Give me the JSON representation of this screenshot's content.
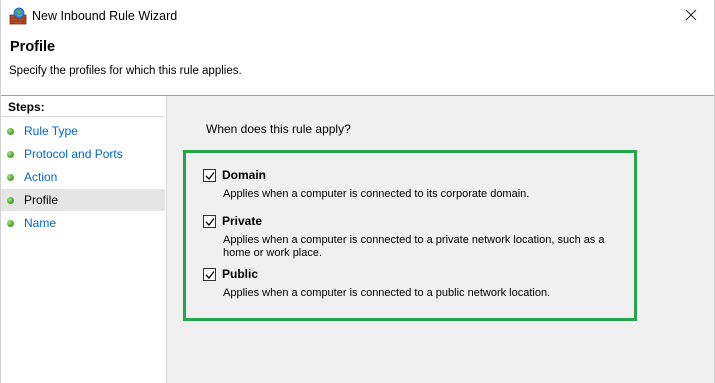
{
  "window": {
    "title": "New Inbound Rule Wizard",
    "app_icon": "firewall-icon",
    "close_icon": "close-icon"
  },
  "header": {
    "title": "Profile",
    "subtitle": "Specify the profiles for which this rule applies."
  },
  "steps": {
    "title": "Steps:",
    "items": [
      {
        "label": "Rule Type",
        "active": false
      },
      {
        "label": "Protocol and Ports",
        "active": false
      },
      {
        "label": "Action",
        "active": false
      },
      {
        "label": "Profile",
        "active": true
      },
      {
        "label": "Name",
        "active": false
      }
    ]
  },
  "main": {
    "question": "When does this rule apply?",
    "options": [
      {
        "label": "Domain",
        "checked": true,
        "description": "Applies when a computer is connected to its corporate domain."
      },
      {
        "label": "Private",
        "checked": true,
        "description": "Applies when a computer is connected to a private network location, such as a home or work place."
      },
      {
        "label": "Public",
        "checked": true,
        "description": "Applies when a computer is connected to a public network location."
      }
    ]
  },
  "colors": {
    "highlight_border": "#22a84a",
    "step_link": "#0066cc",
    "content_bg": "#f0f0f0",
    "active_step_bg": "#e5e5e5"
  }
}
